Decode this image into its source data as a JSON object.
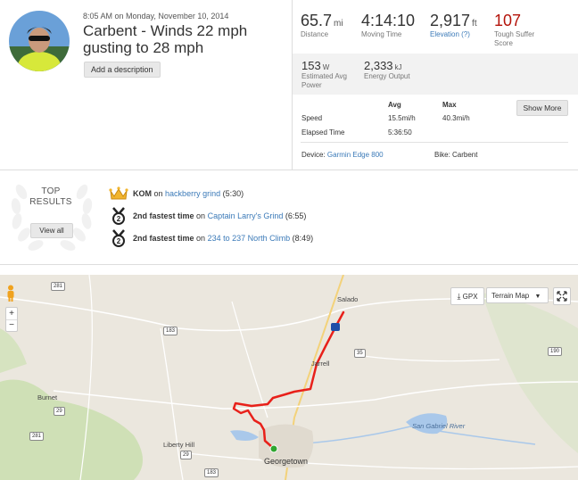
{
  "header": {
    "date": "8:05 AM on Monday, November 10, 2014",
    "title": "Carbent - Winds 22 mph gusting to 28 mph",
    "add_description": "Add a description"
  },
  "stats": [
    {
      "value": "65.7",
      "unit": "mi",
      "label": "Distance"
    },
    {
      "value": "4:14:10",
      "unit": "",
      "label": "Moving Time"
    },
    {
      "value": "2,917",
      "unit": "ft",
      "label": "Elevation (?)"
    },
    {
      "value": "107",
      "unit": "",
      "label": "Tough Suffer Score"
    }
  ],
  "stats2": [
    {
      "value": "153",
      "unit": "W",
      "label": "Estimated Avg Power"
    },
    {
      "value": "2,333",
      "unit": "kJ",
      "label": "Energy Output"
    }
  ],
  "table": {
    "col_avg": "Avg",
    "col_max": "Max",
    "speed_label": "Speed",
    "speed_avg": "15.5mi/h",
    "speed_max": "40.3mi/h",
    "elapsed_label": "Elapsed Time",
    "elapsed_avg": "5:36:50",
    "show_more": "Show More"
  },
  "device": {
    "label": "Device:",
    "name": "Garmin Edge 800",
    "bike_label": "Bike: Carbent"
  },
  "top_results": {
    "title_line1": "TOP",
    "title_line2": "RESULTS",
    "view_all": "View all",
    "items": [
      {
        "badge": "crown-icon",
        "rank": "KOM",
        "on": "on",
        "segment": "hackberry grind",
        "time": "(5:30)"
      },
      {
        "badge": "medal-2-icon",
        "rank": "2nd fastest time",
        "on": "on",
        "segment": "Captain Larry's Grind",
        "time": "(6:55)"
      },
      {
        "badge": "medal-2-icon",
        "rank": "2nd fastest time",
        "on": "on",
        "segment": "234 to 237 North Climb",
        "time": "(8:49)"
      }
    ]
  },
  "map": {
    "gpx_button": "GPX",
    "map_type": "Terrain Map",
    "zoom_in": "+",
    "zoom_out": "−",
    "places": [
      "Salado",
      "Jarrell",
      "Burnet",
      "Liberty Hill",
      "Georgetown",
      "San Gabriel River"
    ],
    "shields": [
      "281",
      "183",
      "35",
      "190",
      "29",
      "281",
      "183",
      "29"
    ]
  },
  "colors": {
    "accent_red": "#b4140b",
    "link_blue": "#3b7ab8",
    "route_red": "#e8201a",
    "start_green": "#2fa52f"
  }
}
